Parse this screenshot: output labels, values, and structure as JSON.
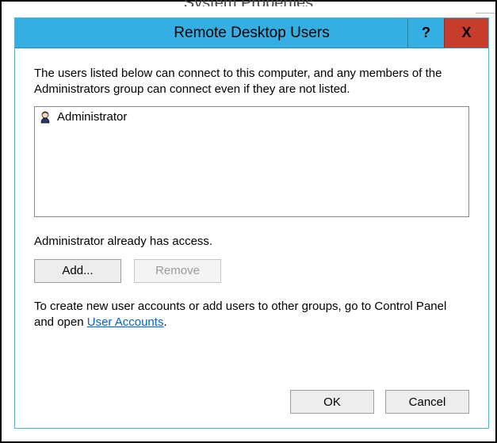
{
  "parent_window_title": "System Properties",
  "dialog": {
    "title": "Remote Desktop Users",
    "help_glyph": "?",
    "close_glyph": "X",
    "intro": "The users listed below can connect to this computer, and any members of the Administrators group can connect even if they are not listed.",
    "users": [
      {
        "name": "Administrator"
      }
    ],
    "status": "Administrator already has access.",
    "buttons": {
      "add": "Add...",
      "remove": "Remove"
    },
    "hint_pre": "To create new user accounts or add users to other groups, go to Control Panel and open ",
    "hint_link": "User Accounts",
    "hint_post": ".",
    "footer": {
      "ok": "OK",
      "cancel": "Cancel"
    }
  }
}
